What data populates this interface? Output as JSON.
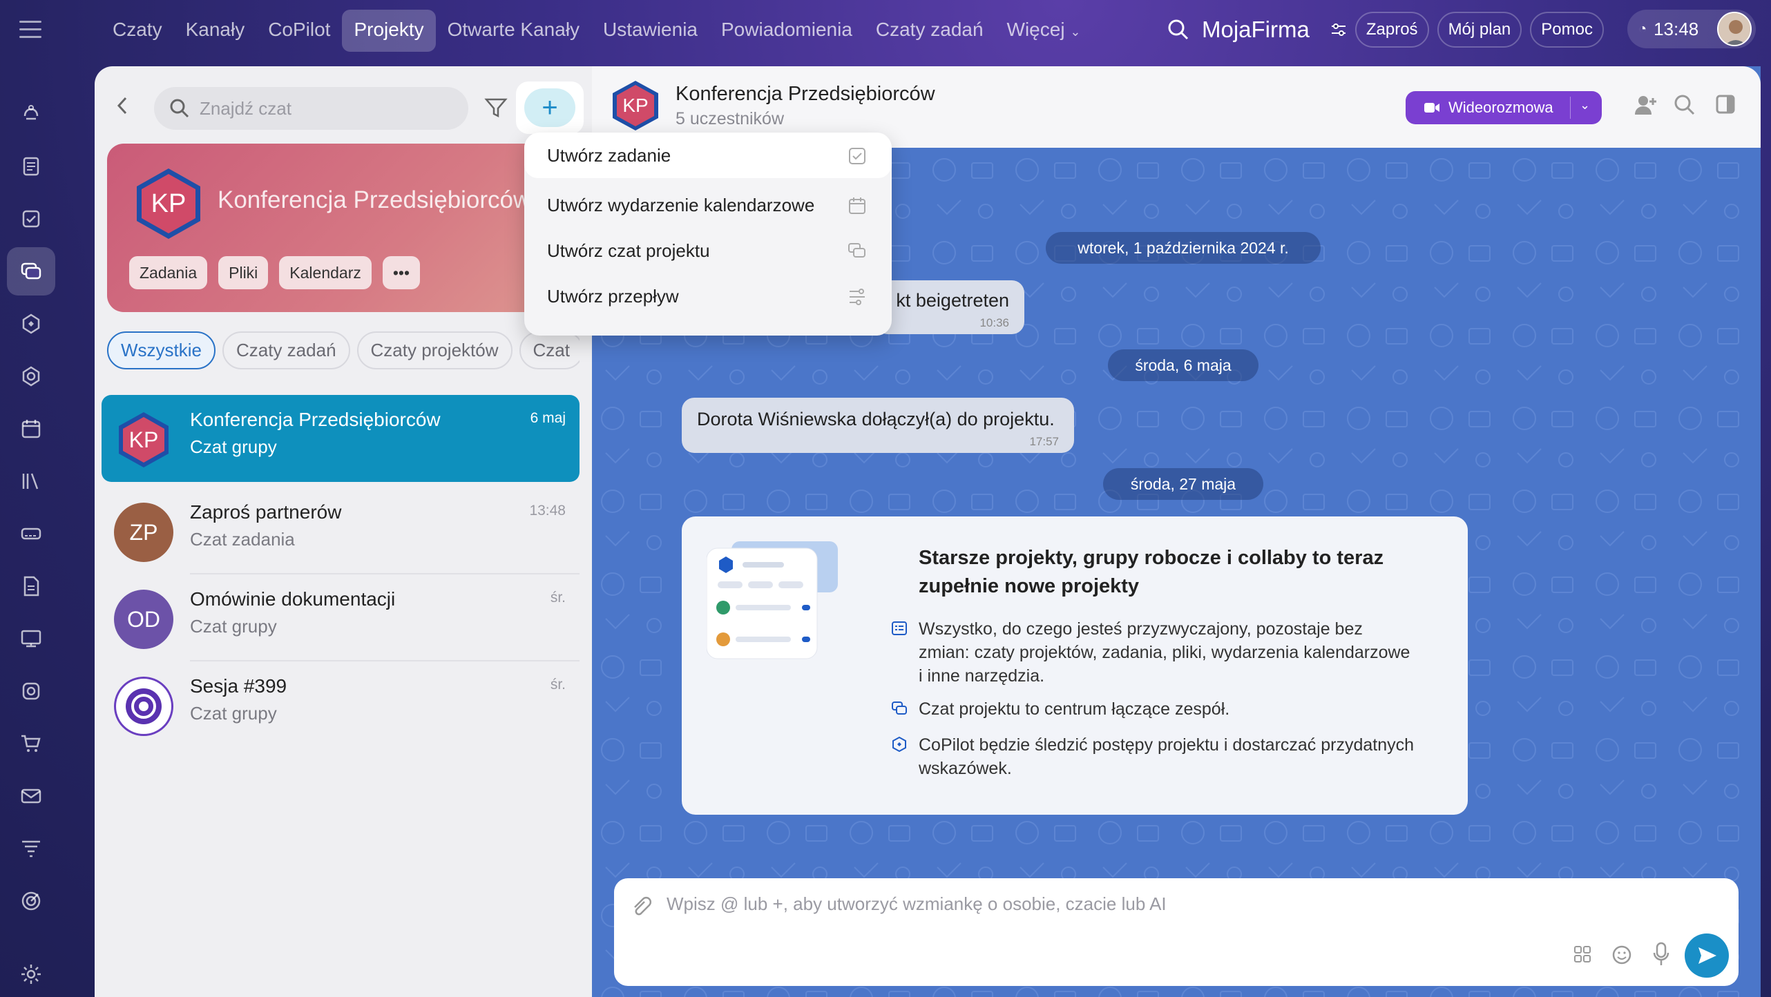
{
  "topnav": {
    "items": [
      "Czaty",
      "Kanały",
      "CoPilot",
      "Projekty",
      "Otwarte Kanały",
      "Ustawienia",
      "Powiadomienia",
      "Czaty zadań",
      "Więcej"
    ],
    "active": "Projekty",
    "brand": "MojaFirma",
    "invite": "Zaproś",
    "plan": "Mój plan",
    "help": "Pomoc",
    "time": "13:48"
  },
  "sidebar": {
    "icons": [
      "copilot-icon",
      "feed-icon",
      "tasks-icon",
      "chats-icon",
      "ai-icon",
      "groups-icon",
      "calendar-icon",
      "knowledge-icon",
      "crm-icon",
      "documents-icon",
      "presentations-icon",
      "drive-icon",
      "shop-icon",
      "mail-icon",
      "funnel-icon",
      "target-icon",
      "settings-icon"
    ]
  },
  "left": {
    "search_placeholder": "Znajdź czat",
    "project_card": {
      "initials": "KP",
      "title": "Konferencja Przedsiębiorców",
      "chips": [
        "Zadania",
        "Pliki",
        "Kalendarz"
      ]
    },
    "filters": [
      "Wszystkie",
      "Czaty zadań",
      "Czaty projektów",
      "Czat"
    ],
    "chats": [
      {
        "initials": "KP",
        "name": "Konferencja Przedsiębiorców",
        "sub": "Czat grupy",
        "time": "6 maj"
      },
      {
        "initials": "ZP",
        "name": "Zaproś partnerów",
        "sub": "Czat zadania",
        "time": "13:48"
      },
      {
        "initials": "OD",
        "name": "Omówinie dokumentacji",
        "sub": "Czat grupy",
        "time": "śr."
      },
      {
        "initials": "",
        "name": "Sesja #399",
        "sub": "Czat grupy",
        "time": "śr."
      }
    ]
  },
  "menu": {
    "items": [
      "Utwórz zadanie",
      "Utwórz wydarzenie kalendarzowe",
      "Utwórz czat projektu",
      "Utwórz przepływ"
    ]
  },
  "chat": {
    "initials": "KP",
    "title": "Konferencja Przedsiębiorców",
    "subtitle": "5 uczestników",
    "video_button": "Wideorozmowa",
    "dates": [
      "wtorek, 1 października 2024 r.",
      "środa, 6 maja",
      "środa, 27 maja"
    ],
    "messages": [
      {
        "text": "kt beigetreten",
        "time": "10:36"
      },
      {
        "text": "Dorota Wiśniewska dołączył(a) do projektu.",
        "time": "17:57"
      }
    ],
    "info": {
      "title": "Starsze projekty, grupy robocze i collaby to teraz zupełnie nowe projekty",
      "items": [
        "Wszystko, do czego jesteś przyzwyczajony, pozostaje bez zmian: czaty projektów, zadania, pliki, wydarzenia kalendarzowe i inne narzędzia.",
        "Czat projektu to centrum łączące zespół.",
        "CoPilot będzie śledzić postępy projektu i dostarczać przydatnych wskazówek."
      ]
    },
    "composer_placeholder": "Wpisz @ lub +, aby utworzyć wzmiankę o osobie, czacie lub AI"
  },
  "colors": {
    "accent": "#0e90bd",
    "video": "#7a3fd1",
    "chat_bg": "#4b76c9",
    "card": "#ca5b78"
  }
}
